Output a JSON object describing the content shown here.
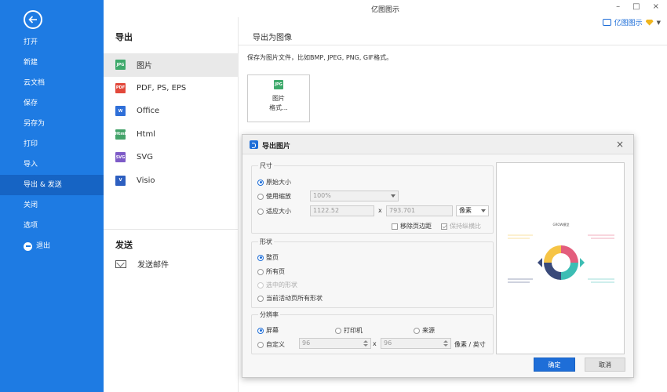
{
  "app": {
    "title": "亿图图示",
    "user_label": "亿图图示"
  },
  "window": {
    "minimize": "–",
    "maximize": "□",
    "close": "×"
  },
  "sidebar": {
    "items": [
      {
        "label": "打开"
      },
      {
        "label": "新建"
      },
      {
        "label": "云文档"
      },
      {
        "label": "保存"
      },
      {
        "label": "另存为"
      },
      {
        "label": "打印"
      },
      {
        "label": "导入"
      },
      {
        "label": "导出 & 发送",
        "active": true
      },
      {
        "label": "关闭"
      },
      {
        "label": "选项"
      },
      {
        "label": "退出"
      }
    ]
  },
  "export_panel": {
    "heading": "导出",
    "formats": [
      {
        "label": "图片",
        "icon": "JPG",
        "active": true
      },
      {
        "label": "PDF, PS, EPS",
        "icon": "PDF"
      },
      {
        "label": "Office",
        "icon": "W"
      },
      {
        "label": "Html",
        "icon": "Html"
      },
      {
        "label": "SVG",
        "icon": "SVG"
      },
      {
        "label": "Visio",
        "icon": "V"
      }
    ],
    "send_heading": "发送",
    "send_mail": "发送邮件"
  },
  "content": {
    "title": "导出为图像",
    "description": "保存为图片文件，比如BMP, JPEG, PNG, GIF格式。",
    "tile_icon": "JPG",
    "tile_label_1": "图片",
    "tile_label_2": "格式..."
  },
  "dialog": {
    "title": "导出图片",
    "close": "×",
    "size": {
      "legend": "尺寸",
      "original": "原始大小",
      "use_scale": "使用缩放",
      "scale_value": "100%",
      "fit_size": "适应大小",
      "width": "1122.52",
      "height": "793.701",
      "x": "x",
      "unit": "像素",
      "remove_margin": "移除页边距",
      "keep_ratio": "保持纵横比"
    },
    "shape": {
      "legend": "形状",
      "whole_page": "整页",
      "all_pages": "所有页",
      "selected_shapes": "选中的形状",
      "all_shapes_current": "当前活动页所有形状"
    },
    "resolution": {
      "legend": "分辨率",
      "screen": "屏幕",
      "printer": "打印机",
      "source": "来源",
      "custom": "自定义",
      "dpi_x": "96",
      "dpi_y": "96",
      "x": "x",
      "unit": "像素 / 英寸"
    },
    "preview_title": "GROW模型",
    "ok": "确定",
    "cancel": "取消"
  },
  "colors": {
    "sidebar_bg": "#1e7be3",
    "sidebar_active": "#1664c4",
    "primary_button": "#1e6ed8",
    "grow_yellow": "#f6c445",
    "grow_pink": "#e35d7c",
    "grow_teal": "#3dbdb4",
    "grow_navy": "#3a4a7a"
  }
}
